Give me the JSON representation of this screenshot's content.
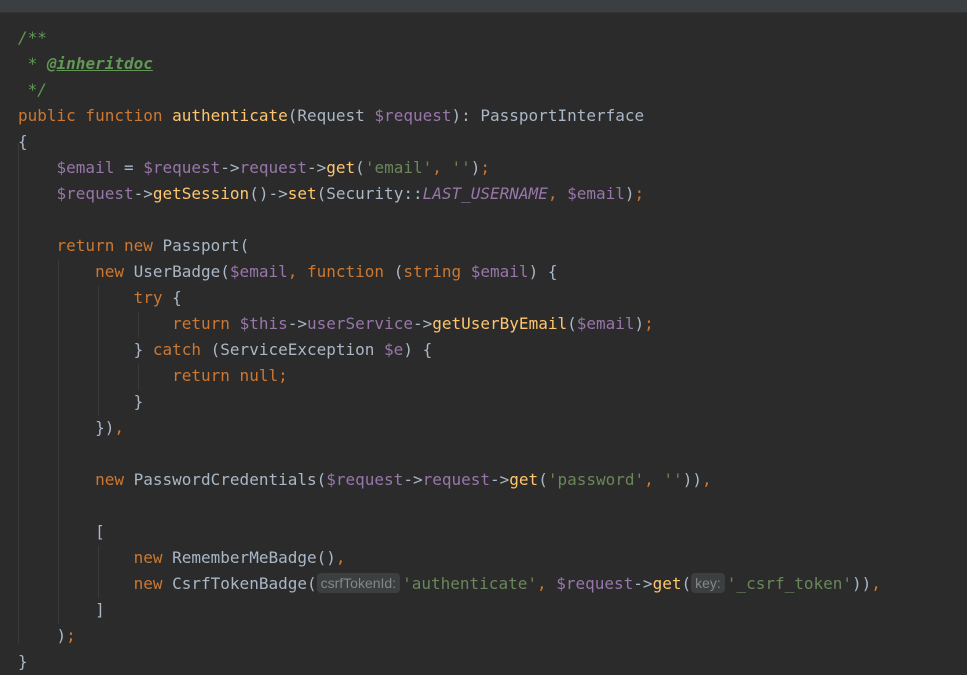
{
  "editor": {
    "language": "PHP",
    "theme_colors": {
      "background": "#2b2b2b",
      "keyword": "#cc7832",
      "function": "#ffc66d",
      "variable": "#9876aa",
      "string": "#6a8759",
      "comment": "#629755",
      "plain": "#a9b7c6"
    },
    "lines": [
      [
        {
          "c": "cm",
          "t": "/**"
        }
      ],
      [
        {
          "c": "cm",
          "t": " * "
        },
        {
          "c": "doctag",
          "t": "@inheritdoc"
        }
      ],
      [
        {
          "c": "cm",
          "t": " */"
        }
      ],
      [
        {
          "c": "kw",
          "t": "public function "
        },
        {
          "c": "fn",
          "t": "authenticate"
        },
        {
          "c": "",
          "t": "(Request "
        },
        {
          "c": "var",
          "t": "$request"
        },
        {
          "c": "",
          "t": "): PassportInterface"
        }
      ],
      [
        {
          "c": "",
          "t": "{"
        }
      ],
      [
        {
          "c": "",
          "t": "    "
        },
        {
          "c": "var",
          "t": "$email"
        },
        {
          "c": "",
          "t": " = "
        },
        {
          "c": "var",
          "t": "$request"
        },
        {
          "c": "",
          "t": "->"
        },
        {
          "c": "var",
          "t": "request"
        },
        {
          "c": "",
          "t": "->"
        },
        {
          "c": "fn",
          "t": "get"
        },
        {
          "c": "",
          "t": "("
        },
        {
          "c": "str",
          "t": "'email'"
        },
        {
          "c": "kw",
          "t": ", "
        },
        {
          "c": "str",
          "t": "''"
        },
        {
          "c": "",
          "t": ")"
        },
        {
          "c": "kw",
          "t": ";"
        }
      ],
      [
        {
          "c": "",
          "t": "    "
        },
        {
          "c": "var",
          "t": "$request"
        },
        {
          "c": "",
          "t": "->"
        },
        {
          "c": "fn",
          "t": "getSession"
        },
        {
          "c": "",
          "t": "()->"
        },
        {
          "c": "fn",
          "t": "set"
        },
        {
          "c": "",
          "t": "(Security::"
        },
        {
          "c": "const",
          "t": "LAST_USERNAME"
        },
        {
          "c": "kw",
          "t": ", "
        },
        {
          "c": "var",
          "t": "$email"
        },
        {
          "c": "",
          "t": ")"
        },
        {
          "c": "kw",
          "t": ";"
        }
      ],
      [],
      [
        {
          "c": "",
          "t": "    "
        },
        {
          "c": "kw",
          "t": "return new "
        },
        {
          "c": "",
          "t": "Passport("
        }
      ],
      [
        {
          "c": "",
          "t": "        "
        },
        {
          "c": "kw",
          "t": "new "
        },
        {
          "c": "",
          "t": "UserBadge("
        },
        {
          "c": "var",
          "t": "$email"
        },
        {
          "c": "kw",
          "t": ", function "
        },
        {
          "c": "",
          "t": "("
        },
        {
          "c": "kw",
          "t": "string "
        },
        {
          "c": "var",
          "t": "$email"
        },
        {
          "c": "",
          "t": ") {"
        }
      ],
      [
        {
          "c": "",
          "t": "            "
        },
        {
          "c": "kw",
          "t": "try "
        },
        {
          "c": "",
          "t": "{"
        }
      ],
      [
        {
          "c": "",
          "t": "                "
        },
        {
          "c": "kw",
          "t": "return "
        },
        {
          "c": "var",
          "t": "$this"
        },
        {
          "c": "",
          "t": "->"
        },
        {
          "c": "var",
          "t": "userService"
        },
        {
          "c": "",
          "t": "->"
        },
        {
          "c": "fn",
          "t": "getUserByEmail"
        },
        {
          "c": "",
          "t": "("
        },
        {
          "c": "var",
          "t": "$email"
        },
        {
          "c": "",
          "t": ")"
        },
        {
          "c": "kw",
          "t": ";"
        }
      ],
      [
        {
          "c": "",
          "t": "            } "
        },
        {
          "c": "kw",
          "t": "catch "
        },
        {
          "c": "",
          "t": "(ServiceException "
        },
        {
          "c": "var",
          "t": "$e"
        },
        {
          "c": "",
          "t": ") {"
        }
      ],
      [
        {
          "c": "",
          "t": "                "
        },
        {
          "c": "kw",
          "t": "return null;"
        }
      ],
      [
        {
          "c": "",
          "t": "            }"
        }
      ],
      [
        {
          "c": "",
          "t": "        })"
        },
        {
          "c": "kw",
          "t": ","
        }
      ],
      [],
      [
        {
          "c": "",
          "t": "        "
        },
        {
          "c": "kw",
          "t": "new "
        },
        {
          "c": "",
          "t": "PasswordCredentials("
        },
        {
          "c": "var",
          "t": "$request"
        },
        {
          "c": "",
          "t": "->"
        },
        {
          "c": "var",
          "t": "request"
        },
        {
          "c": "",
          "t": "->"
        },
        {
          "c": "fn",
          "t": "get"
        },
        {
          "c": "",
          "t": "("
        },
        {
          "c": "str",
          "t": "'password'"
        },
        {
          "c": "kw",
          "t": ", "
        },
        {
          "c": "str",
          "t": "''"
        },
        {
          "c": "",
          "t": "))"
        },
        {
          "c": "kw",
          "t": ","
        }
      ],
      [],
      [
        {
          "c": "",
          "t": "        ["
        }
      ],
      [
        {
          "c": "",
          "t": "            "
        },
        {
          "c": "kw",
          "t": "new "
        },
        {
          "c": "",
          "t": "RememberMeBadge()"
        },
        {
          "c": "kw",
          "t": ","
        }
      ],
      [
        {
          "c": "",
          "t": "            "
        },
        {
          "c": "kw",
          "t": "new "
        },
        {
          "c": "",
          "t": "CsrfTokenBadge("
        },
        {
          "c": "hint",
          "t": "csrfTokenId:"
        },
        {
          "c": "str",
          "t": "'authenticate'"
        },
        {
          "c": "kw",
          "t": ", "
        },
        {
          "c": "var",
          "t": "$request"
        },
        {
          "c": "",
          "t": "->"
        },
        {
          "c": "fn",
          "t": "get"
        },
        {
          "c": "",
          "t": "("
        },
        {
          "c": "hint",
          "t": "key:"
        },
        {
          "c": "str",
          "t": "'_csrf_token'"
        },
        {
          "c": "",
          "t": "))"
        },
        {
          "c": "kw",
          "t": ","
        }
      ],
      [
        {
          "c": "",
          "t": "        ]"
        }
      ],
      [
        {
          "c": "",
          "t": "    )"
        },
        {
          "c": "kw",
          "t": ";"
        }
      ],
      [
        {
          "c": "",
          "t": "}"
        }
      ]
    ]
  }
}
